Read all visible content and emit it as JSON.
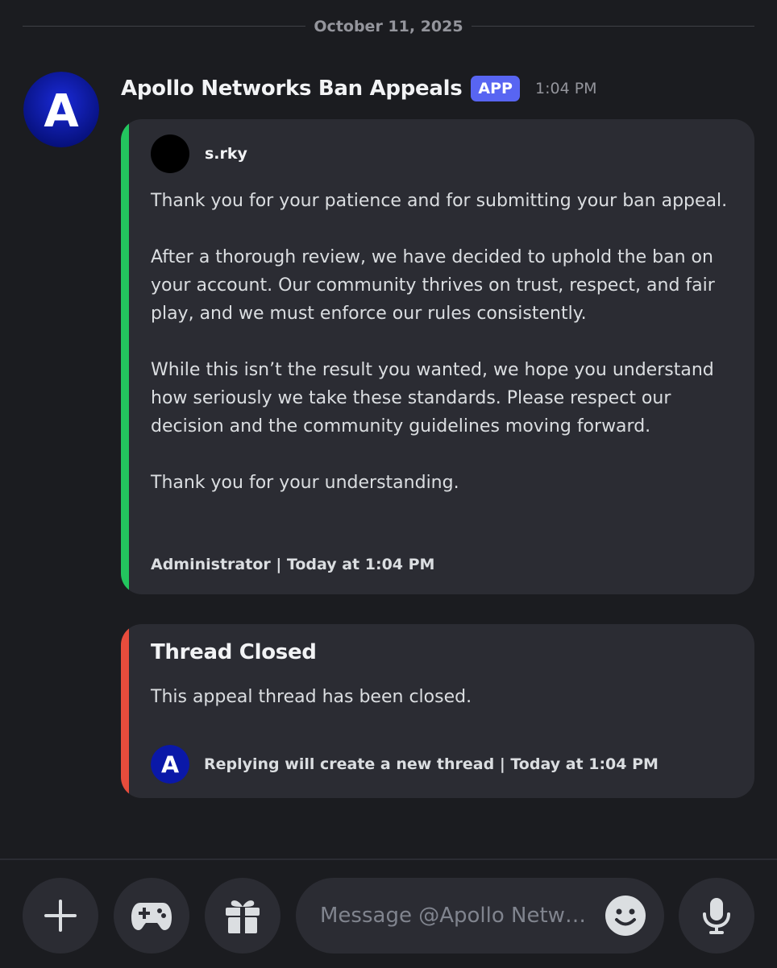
{
  "date_divider": "October 11, 2025",
  "message": {
    "author": "Apollo Networks Ban Appeals",
    "badge": "APP",
    "timestamp": "1:04 PM",
    "avatar_letter": "A"
  },
  "embed1": {
    "author_name": "s.rky",
    "paragraphs": [
      "Thank you for your patience and for submitting your ban appeal.",
      "After a thorough review, we have decided to uphold the ban on your account. Our community thrives on trust, respect, and fair play, and we must enforce our rules consistently.",
      "While this isn’t the result you wanted, we hope you understand how seriously we take these standards. Please respect our decision and the community guidelines moving forward.",
      "Thank you for your understanding."
    ],
    "footer": "Administrator | Today at 1:04 PM",
    "accent_color": "#23c55e"
  },
  "embed2": {
    "title": "Thread Closed",
    "description": "This appeal thread has been closed.",
    "footer": "Replying will create a new thread | Today at 1:04 PM",
    "accent_color": "#e74c3c"
  },
  "composer": {
    "placeholder": "Message @Apollo Netw…",
    "buttons": [
      "plus-icon",
      "gamepad-icon",
      "gift-icon",
      "emoji-icon",
      "microphone-icon"
    ]
  },
  "colors": {
    "background": "#1b1c20",
    "embed_bg": "#2b2c33",
    "badge": "#5865f2"
  }
}
